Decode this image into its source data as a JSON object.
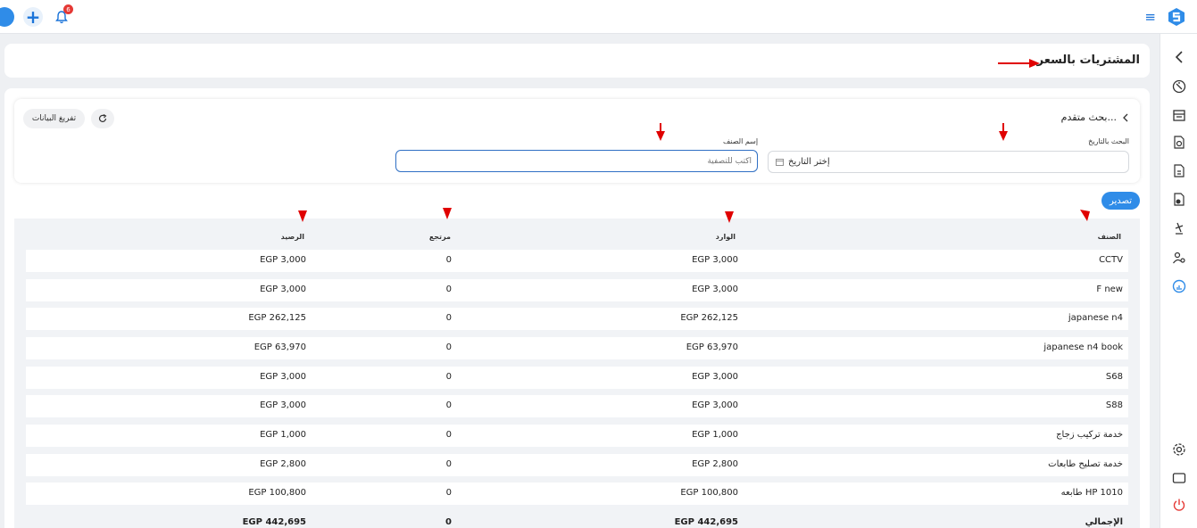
{
  "topbar": {
    "notification_count": "6"
  },
  "page": {
    "title": "المشتريات بالسعر"
  },
  "search": {
    "advanced_label": "بحث متقدم...",
    "reset_label": "تفريغ البيانات",
    "date_label": "البحث بالتاريخ",
    "date_placeholder": "إختر التاريخ",
    "item_label": "إسم الصنف",
    "item_placeholder": "أكتب للتصفية"
  },
  "export_label": "تصدير",
  "table": {
    "headers": {
      "item": "الصنف",
      "incoming": "الوارد",
      "returned": "مرتجع",
      "balance": "الرصيد"
    },
    "rows": [
      {
        "item": "CCTV",
        "incoming": "EGP 3,000",
        "returned": "0",
        "balance": "EGP 3,000"
      },
      {
        "item": "F new",
        "incoming": "EGP 3,000",
        "returned": "0",
        "balance": "EGP 3,000"
      },
      {
        "item": "japanese n4",
        "incoming": "EGP 262,125",
        "returned": "0",
        "balance": "EGP 262,125"
      },
      {
        "item": "japanese n4 book",
        "incoming": "EGP 63,970",
        "returned": "0",
        "balance": "EGP 63,970"
      },
      {
        "item": "S68",
        "incoming": "EGP 3,000",
        "returned": "0",
        "balance": "EGP 3,000"
      },
      {
        "item": "S88",
        "incoming": "EGP 3,000",
        "returned": "0",
        "balance": "EGP 3,000"
      },
      {
        "item": "خدمة تركيب زجاج",
        "incoming": "EGP 1,000",
        "returned": "0",
        "balance": "EGP 1,000"
      },
      {
        "item": "خدمة تصليح طابعات",
        "incoming": "EGP 2,800",
        "returned": "0",
        "balance": "EGP 2,800"
      },
      {
        "item": "طابعه HP 1010",
        "incoming": "EGP 100,800",
        "returned": "0",
        "balance": "EGP 100,800"
      }
    ],
    "total": {
      "item": "الإجمالي",
      "incoming": "EGP 442,695",
      "returned": "0",
      "balance": "EGP 442,695"
    }
  },
  "colors": {
    "accent": "#2f8ce8",
    "annotation": "#e00000"
  }
}
